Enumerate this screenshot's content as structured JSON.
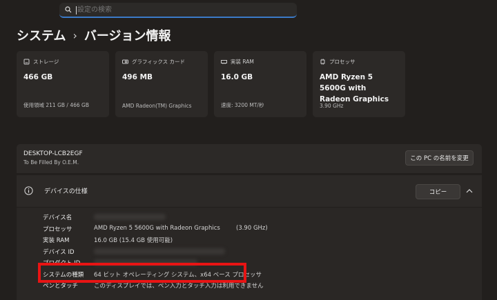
{
  "search": {
    "placeholder": "設定の検索"
  },
  "breadcrumb": {
    "parent": "システム",
    "separator": "›",
    "current": "バージョン情報"
  },
  "cards": [
    {
      "icon": "storage-icon",
      "label": "ストレージ",
      "value": "466 GB",
      "sub": "使用領域 211 GB / 466 GB"
    },
    {
      "icon": "graphics-card-icon",
      "label": "グラフィックス カード",
      "value": "496 MB",
      "sub": "AMD Radeon(TM) Graphics"
    },
    {
      "icon": "ram-icon",
      "label": "実装 RAM",
      "value": "16.0 GB",
      "sub": "速度: 3200 MT/秒"
    },
    {
      "icon": "processor-icon",
      "label": "プロセッサ",
      "value": "AMD Ryzen 5 5600G with Radeon Graphics",
      "sub": "3.90 GHz"
    }
  ],
  "device": {
    "name": "DESKTOP-LCB2EGF",
    "sub": "To Be Filled By O.E.M.",
    "rename_label": "この PC の名前を変更"
  },
  "spec": {
    "title": "デバイスの仕様",
    "copy_label": "コピー",
    "rows": [
      {
        "label": "デバイス名",
        "value": ""
      },
      {
        "label": "プロセッサ",
        "value": "AMD Ryzen 5 5600G with Radeon Graphics",
        "extra": "(3.90 GHz)"
      },
      {
        "label": "実装 RAM",
        "value": "16.0 GB (15.4 GB 使用可能)"
      },
      {
        "label": "デバイス ID",
        "value": ""
      },
      {
        "label": "プロダクト ID",
        "value": ""
      },
      {
        "label": "システムの種類",
        "value": "64 ビット オペレーティング システム、x64 ベース プロセッサ"
      },
      {
        "label": "ペンとタッチ",
        "value": "このディスプレイでは、ペン入力とタッチ入力は利用できません"
      }
    ]
  },
  "colors": {
    "accent": "#3b7bc9",
    "highlight": "#e81414",
    "background": "#221f1d",
    "panel": "#2c2927"
  }
}
